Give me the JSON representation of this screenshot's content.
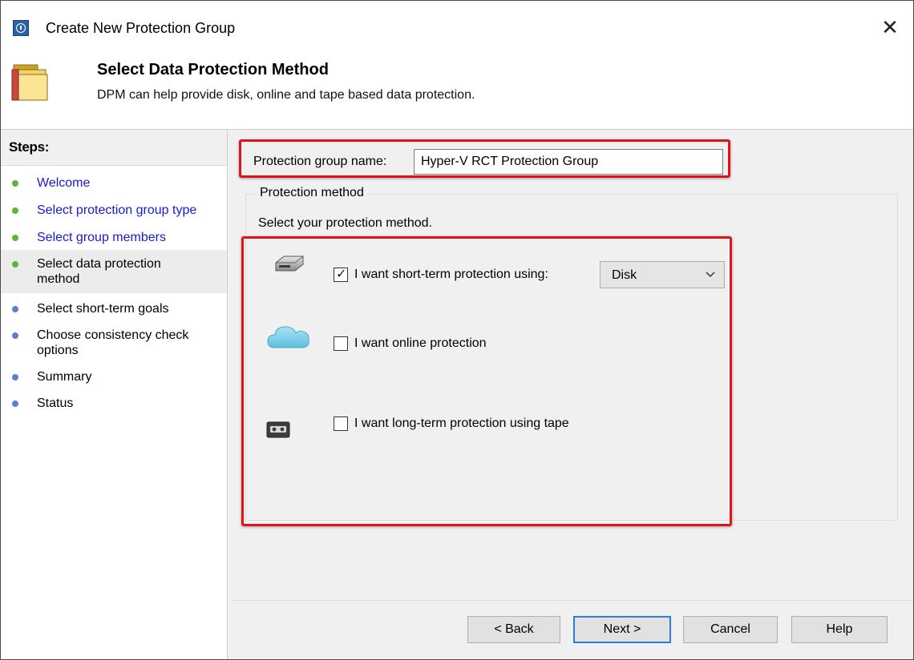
{
  "window": {
    "title": "Create New Protection Group",
    "close_symbol": "✕"
  },
  "header": {
    "title": "Select Data Protection Method",
    "description": "DPM can help provide disk, online and tape based data protection."
  },
  "steps": {
    "heading": "Steps:",
    "items": [
      {
        "label": "Welcome",
        "state": "done"
      },
      {
        "label": "Select protection group type",
        "state": "done"
      },
      {
        "label": "Select group members",
        "state": "done"
      },
      {
        "label": "Select data protection method",
        "state": "current"
      },
      {
        "label": "Select short-term goals",
        "state": "pending"
      },
      {
        "label": "Choose consistency check options",
        "state": "pending"
      },
      {
        "label": "Summary",
        "state": "pending"
      },
      {
        "label": "Status",
        "state": "pending"
      }
    ]
  },
  "form": {
    "group_name_label": "Protection group name:",
    "group_name_value": "Hyper-V RCT Protection Group",
    "method_legend": "Protection method",
    "method_instruction": "Select your protection method.",
    "options": [
      {
        "label": "I want short-term protection using:",
        "checked": true,
        "icon": "disk-drive-icon"
      },
      {
        "label": "I want online protection",
        "checked": false,
        "icon": "cloud-icon"
      },
      {
        "label": "I want long-term protection using tape",
        "checked": false,
        "icon": "tape-icon"
      }
    ],
    "short_term_media": {
      "selected": "Disk"
    }
  },
  "buttons": {
    "back": "< Back",
    "next": "Next >",
    "cancel": "Cancel",
    "help": "Help"
  },
  "colors": {
    "highlight": "#e0131a",
    "done_dot": "#5fb43a",
    "pending_dot": "#5d7fd1",
    "link": "#1a1ad0"
  }
}
